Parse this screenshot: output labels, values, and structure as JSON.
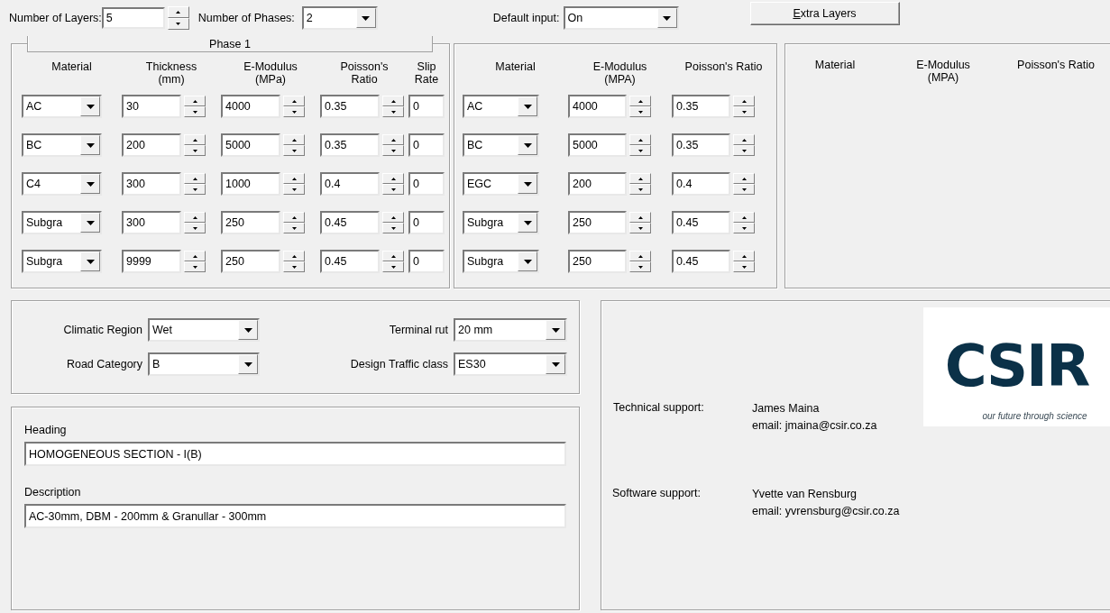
{
  "toolbar": {
    "layers_label": "Number of Layers:",
    "layers_value": "5",
    "phases_label": "Number of Phases:",
    "phases_value": "2",
    "default_label": "Default input:",
    "default_value": "On",
    "extra_button": "Extra Layers"
  },
  "phase_1": {
    "title": "Phase 1",
    "columns": [
      "Material",
      "Thickness\n(mm)",
      "E-Modulus\n(MPa)",
      "Poisson's\nRatio",
      "Slip\nRate"
    ],
    "rows": [
      {
        "material": "AC",
        "thickness": "30",
        "modulus": "4000",
        "poisson": "0.35",
        "slip": "0"
      },
      {
        "material": "BC",
        "thickness": "200",
        "modulus": "5000",
        "poisson": "0.35",
        "slip": "0"
      },
      {
        "material": "C4",
        "thickness": "300",
        "modulus": "1000",
        "poisson": "0.4",
        "slip": "0"
      },
      {
        "material": "Subgra",
        "thickness": "300",
        "modulus": "250",
        "poisson": "0.45",
        "slip": "0"
      },
      {
        "material": "Subgra",
        "thickness": "9999",
        "modulus": "250",
        "poisson": "0.45",
        "slip": "0"
      }
    ]
  },
  "phase_2": {
    "columns": [
      "Material",
      "E-Modulus\n(MPA)",
      "Poisson's Ratio"
    ],
    "rows": [
      {
        "material": "AC",
        "modulus": "4000",
        "poisson": "0.35"
      },
      {
        "material": "BC",
        "modulus": "5000",
        "poisson": "0.35"
      },
      {
        "material": "EGC",
        "modulus": "200",
        "poisson": "0.4"
      },
      {
        "material": "Subgra",
        "modulus": "250",
        "poisson": "0.45"
      },
      {
        "material": "Subgra",
        "modulus": "250",
        "poisson": "0.45"
      }
    ]
  },
  "extra_panel": {
    "columns": [
      "Material",
      "E-Modulus\n(MPA)",
      "Poisson's Ratio"
    ]
  },
  "settings": [
    {
      "label": "Climatic Region",
      "value": "Wet"
    },
    {
      "label": "Terminal rut",
      "value": "20 mm"
    },
    {
      "label": "Road Category",
      "value": "B"
    },
    {
      "label": "Design Traffic class",
      "value": "ES30"
    }
  ],
  "section": {
    "heading_label": "Heading",
    "heading_value": "HOMOGENEOUS SECTION - I(B)",
    "description_label": "Description",
    "description_value": "AC-30mm, DBM - 200mm & Granullar - 300mm"
  },
  "logo": {
    "wordmark": "CSIR",
    "tagline": "our future through science"
  },
  "support": [
    {
      "label": "Technical support:",
      "name": "James Maina",
      "email": "email: jmaina@csir.co.za"
    },
    {
      "label": "Software support:",
      "name": "Yvette van Rensburg",
      "email": "email: yvrensburg@csir.co.za"
    }
  ]
}
